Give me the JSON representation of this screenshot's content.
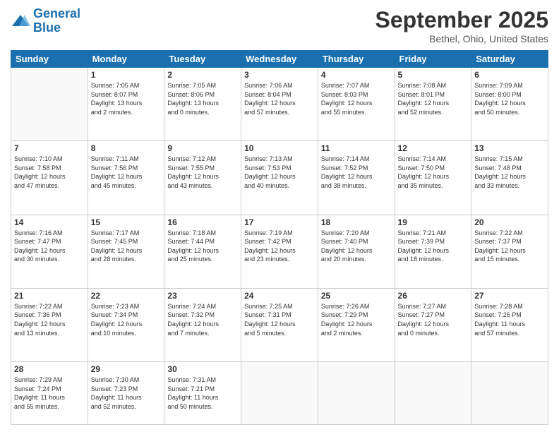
{
  "header": {
    "logo_line1": "General",
    "logo_line2": "Blue",
    "month": "September 2025",
    "location": "Bethel, Ohio, United States"
  },
  "weekdays": [
    "Sunday",
    "Monday",
    "Tuesday",
    "Wednesday",
    "Thursday",
    "Friday",
    "Saturday"
  ],
  "weeks": [
    [
      {
        "day": "",
        "info": ""
      },
      {
        "day": "1",
        "info": "Sunrise: 7:05 AM\nSunset: 8:07 PM\nDaylight: 13 hours\nand 2 minutes."
      },
      {
        "day": "2",
        "info": "Sunrise: 7:05 AM\nSunset: 8:06 PM\nDaylight: 13 hours\nand 0 minutes."
      },
      {
        "day": "3",
        "info": "Sunrise: 7:06 AM\nSunset: 8:04 PM\nDaylight: 12 hours\nand 57 minutes."
      },
      {
        "day": "4",
        "info": "Sunrise: 7:07 AM\nSunset: 8:03 PM\nDaylight: 12 hours\nand 55 minutes."
      },
      {
        "day": "5",
        "info": "Sunrise: 7:08 AM\nSunset: 8:01 PM\nDaylight: 12 hours\nand 52 minutes."
      },
      {
        "day": "6",
        "info": "Sunrise: 7:09 AM\nSunset: 8:00 PM\nDaylight: 12 hours\nand 50 minutes."
      }
    ],
    [
      {
        "day": "7",
        "info": "Sunrise: 7:10 AM\nSunset: 7:58 PM\nDaylight: 12 hours\nand 47 minutes."
      },
      {
        "day": "8",
        "info": "Sunrise: 7:11 AM\nSunset: 7:56 PM\nDaylight: 12 hours\nand 45 minutes."
      },
      {
        "day": "9",
        "info": "Sunrise: 7:12 AM\nSunset: 7:55 PM\nDaylight: 12 hours\nand 43 minutes."
      },
      {
        "day": "10",
        "info": "Sunrise: 7:13 AM\nSunset: 7:53 PM\nDaylight: 12 hours\nand 40 minutes."
      },
      {
        "day": "11",
        "info": "Sunrise: 7:14 AM\nSunset: 7:52 PM\nDaylight: 12 hours\nand 38 minutes."
      },
      {
        "day": "12",
        "info": "Sunrise: 7:14 AM\nSunset: 7:50 PM\nDaylight: 12 hours\nand 35 minutes."
      },
      {
        "day": "13",
        "info": "Sunrise: 7:15 AM\nSunset: 7:48 PM\nDaylight: 12 hours\nand 33 minutes."
      }
    ],
    [
      {
        "day": "14",
        "info": "Sunrise: 7:16 AM\nSunset: 7:47 PM\nDaylight: 12 hours\nand 30 minutes."
      },
      {
        "day": "15",
        "info": "Sunrise: 7:17 AM\nSunset: 7:45 PM\nDaylight: 12 hours\nand 28 minutes."
      },
      {
        "day": "16",
        "info": "Sunrise: 7:18 AM\nSunset: 7:44 PM\nDaylight: 12 hours\nand 25 minutes."
      },
      {
        "day": "17",
        "info": "Sunrise: 7:19 AM\nSunset: 7:42 PM\nDaylight: 12 hours\nand 23 minutes."
      },
      {
        "day": "18",
        "info": "Sunrise: 7:20 AM\nSunset: 7:40 PM\nDaylight: 12 hours\nand 20 minutes."
      },
      {
        "day": "19",
        "info": "Sunrise: 7:21 AM\nSunset: 7:39 PM\nDaylight: 12 hours\nand 18 minutes."
      },
      {
        "day": "20",
        "info": "Sunrise: 7:22 AM\nSunset: 7:37 PM\nDaylight: 12 hours\nand 15 minutes."
      }
    ],
    [
      {
        "day": "21",
        "info": "Sunrise: 7:22 AM\nSunset: 7:36 PM\nDaylight: 12 hours\nand 13 minutes."
      },
      {
        "day": "22",
        "info": "Sunrise: 7:23 AM\nSunset: 7:34 PM\nDaylight: 12 hours\nand 10 minutes."
      },
      {
        "day": "23",
        "info": "Sunrise: 7:24 AM\nSunset: 7:32 PM\nDaylight: 12 hours\nand 7 minutes."
      },
      {
        "day": "24",
        "info": "Sunrise: 7:25 AM\nSunset: 7:31 PM\nDaylight: 12 hours\nand 5 minutes."
      },
      {
        "day": "25",
        "info": "Sunrise: 7:26 AM\nSunset: 7:29 PM\nDaylight: 12 hours\nand 2 minutes."
      },
      {
        "day": "26",
        "info": "Sunrise: 7:27 AM\nSunset: 7:27 PM\nDaylight: 12 hours\nand 0 minutes."
      },
      {
        "day": "27",
        "info": "Sunrise: 7:28 AM\nSunset: 7:26 PM\nDaylight: 11 hours\nand 57 minutes."
      }
    ],
    [
      {
        "day": "28",
        "info": "Sunrise: 7:29 AM\nSunset: 7:24 PM\nDaylight: 11 hours\nand 55 minutes."
      },
      {
        "day": "29",
        "info": "Sunrise: 7:30 AM\nSunset: 7:23 PM\nDaylight: 11 hours\nand 52 minutes."
      },
      {
        "day": "30",
        "info": "Sunrise: 7:31 AM\nSunset: 7:21 PM\nDaylight: 11 hours\nand 50 minutes."
      },
      {
        "day": "",
        "info": ""
      },
      {
        "day": "",
        "info": ""
      },
      {
        "day": "",
        "info": ""
      },
      {
        "day": "",
        "info": ""
      }
    ]
  ]
}
